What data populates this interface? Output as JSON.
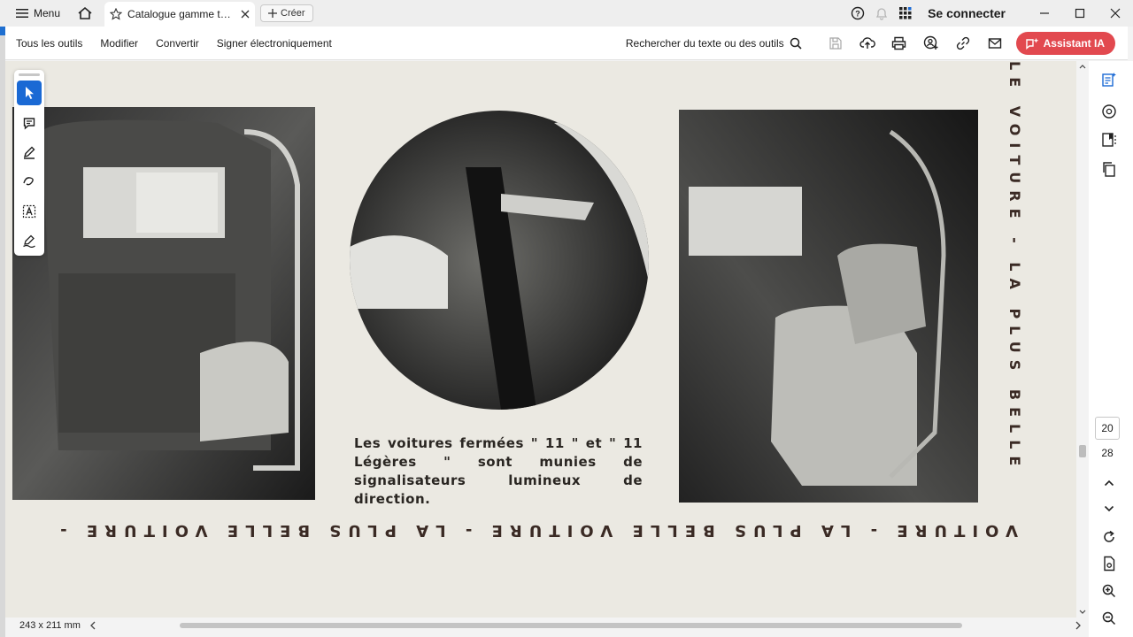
{
  "titlebar": {
    "menu_label": "Menu",
    "tab_title": "Catalogue gamme tou...",
    "create_label": "Créer",
    "connect_label": "Se connecter"
  },
  "toolbar": {
    "items": [
      "Tous les outils",
      "Modifier",
      "Convertir",
      "Signer électroniquement"
    ],
    "search_label": "Rechercher du texte ou des outils",
    "ai_label": "Assistant IA"
  },
  "document": {
    "caption": "Les voitures fermées \" 11 \" et \" 11 Légères \" sont munies de signalisateurs lumineux de direction.",
    "vertical_text": "LE VOITURE - LA PLUS BELLE",
    "upside_down_text": "VOITURE - LA PLUS BELLE VOITURE - LA PLUS BELLE VOITURE -"
  },
  "page_nav": {
    "current": "20",
    "total": "28"
  },
  "status": {
    "dimensions": "243 x 211 mm"
  },
  "colors": {
    "accent": "#1a69d4",
    "ai_button": "#e2494f",
    "paper": "#ebe9e2"
  }
}
